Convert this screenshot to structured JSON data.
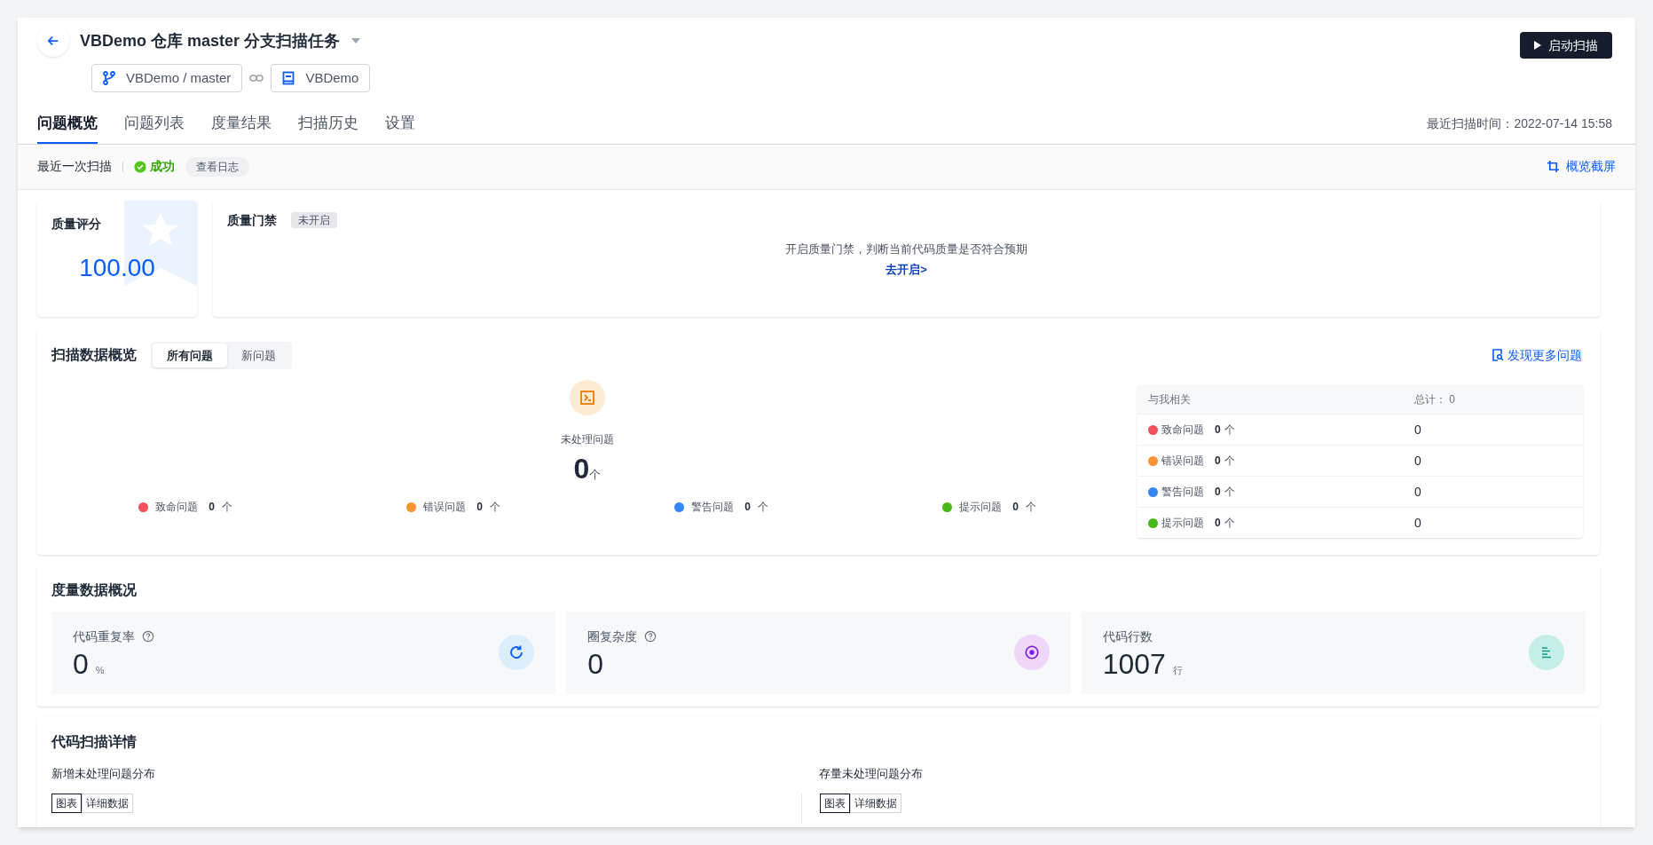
{
  "header": {
    "title": "VBDemo 仓库 master 分支扫描任务",
    "branch": "VBDemo / master",
    "repo": "VBDemo",
    "start_button": "启动扫描"
  },
  "tabs": [
    {
      "label": "问题概览",
      "selected": true
    },
    {
      "label": "问题列表",
      "selected": false
    },
    {
      "label": "度量结果",
      "selected": false
    },
    {
      "label": "扫描历史",
      "selected": false
    },
    {
      "label": "设置",
      "selected": false
    }
  ],
  "last_scan_time": "最近扫描时间：2022-07-14 15:58",
  "status_bar": {
    "label": "最近一次扫描",
    "status": "成功",
    "log_button": "查看日志",
    "screenshot_link": "概览截屏"
  },
  "quality_score": {
    "title": "质量评分",
    "score": "100.00"
  },
  "quality_gate": {
    "title": "质量门禁",
    "badge": "未开启",
    "message": "开启质量门禁，判断当前代码质量是否符合预期",
    "link": "去开启>"
  },
  "scan_overview": {
    "title": "扫描数据概览",
    "segments": [
      {
        "label": "所有问题",
        "selected": true
      },
      {
        "label": "新问题",
        "selected": false
      }
    ],
    "more_link": "发现更多问题",
    "unhandled_label": "未处理问题",
    "unhandled_count": "0",
    "unit": "个",
    "levels": [
      {
        "label": "致命问题",
        "count": "0",
        "unit": "个",
        "color": "#f0505a"
      },
      {
        "label": "错误问题",
        "count": "0",
        "unit": "个",
        "color": "#f99232"
      },
      {
        "label": "警告问题",
        "count": "0",
        "unit": "个",
        "color": "#3386f5"
      },
      {
        "label": "提示问题",
        "count": "0",
        "unit": "个",
        "color": "#47b815"
      }
    ],
    "mine_table": {
      "column_1": "与我相关",
      "column_2": "总计： 0",
      "rows": [
        {
          "label": "致命问题",
          "count": "0",
          "unit": "个",
          "total": "0",
          "color": "#f0505a"
        },
        {
          "label": "错误问题",
          "count": "0",
          "unit": "个",
          "total": "0",
          "color": "#f99232"
        },
        {
          "label": "警告问题",
          "count": "0",
          "unit": "个",
          "total": "0",
          "color": "#3386f5"
        },
        {
          "label": "提示问题",
          "count": "0",
          "unit": "个",
          "total": "0",
          "color": "#47b815"
        }
      ]
    }
  },
  "metrics": {
    "title": "度量数据概况",
    "cards": [
      {
        "kind": "duplication",
        "label": "代码重复率",
        "help": true,
        "value": "0",
        "unit": "%"
      },
      {
        "kind": "complexity",
        "label": "圈复杂度",
        "help": true,
        "value": "0"
      },
      {
        "kind": "lines",
        "label": "代码行数",
        "help": false,
        "value": "1007",
        "unit": "行"
      }
    ]
  },
  "details": {
    "title": "代码扫描详情",
    "panels": [
      {
        "title": "新增未处理问题分布",
        "toggles": [
          {
            "label": "图表",
            "selected": true
          },
          {
            "label": "详细数据",
            "selected": false
          }
        ]
      },
      {
        "title": "存量未处理问题分布",
        "toggles": [
          {
            "label": "图表",
            "selected": true
          },
          {
            "label": "详细数据",
            "selected": false
          }
        ]
      }
    ]
  }
}
